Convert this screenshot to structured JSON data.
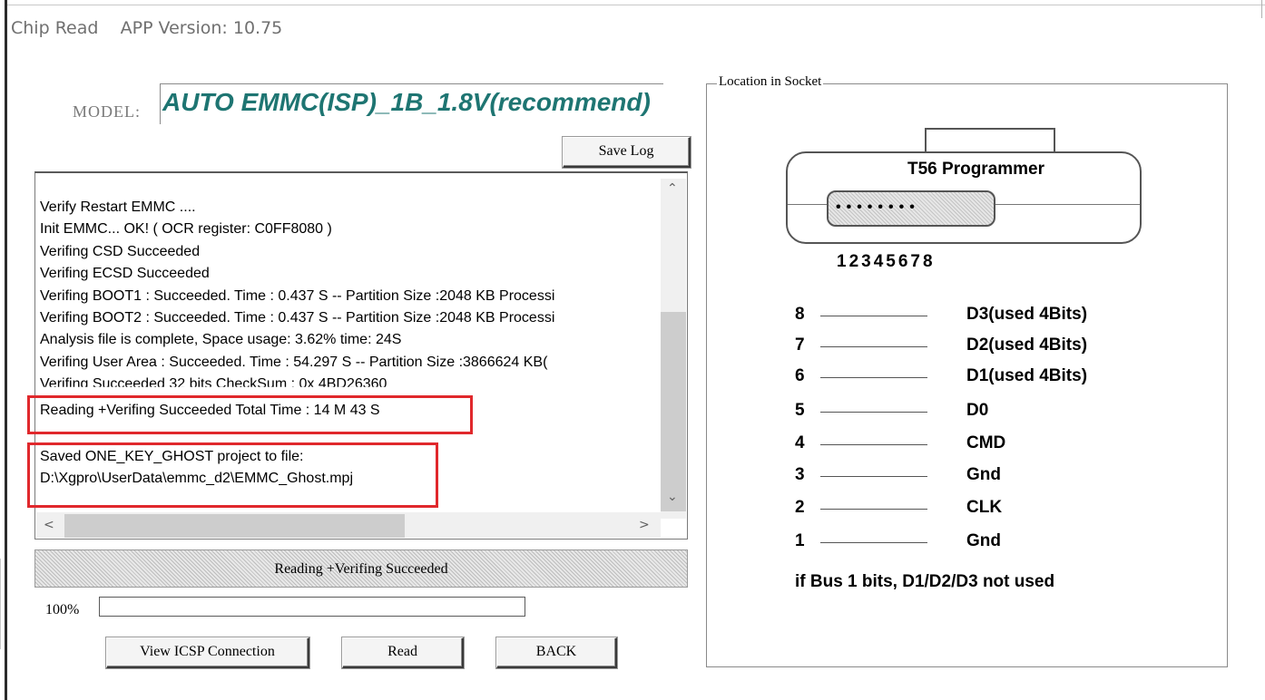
{
  "window": {
    "title": "Chip Read",
    "app_version": "APP Version: 10.75"
  },
  "model": {
    "label": "MODEL:",
    "value": "AUTO EMMC(ISP)_1B_1.8V(recommend)"
  },
  "toolbar": {
    "save_log_label": "Save Log"
  },
  "log": {
    "lines": [
      "Verify Restart EMMC ....",
      "Init EMMC... OK!   ( OCR register: C0FF8080 )",
      "Verifing CSD Succeeded",
      "Verifing ECSD Succeeded",
      "Verifing BOOT1 : Succeeded. Time : 0.437 S -- Partition Size :2048 KB Processi",
      "Verifing BOOT2 : Succeeded. Time : 0.437 S -- Partition Size :2048 KB Processi",
      "Analysis file is complete, Space usage: 3.62% time: 24S",
      "Verifing User Area : Succeeded. Time : 54.297 S -- Partition Size :3866624 KB(",
      "Verifing Succeeded  32 bits CheckSum :  0x 4BD26360",
      "Reading +Verifing  Succeeded   Total Time : 14 M 43 S",
      "",
      "Saved ONE_KEY_GHOST project to file:",
      "D:\\Xgpro\\UserData\\emmc_d2\\EMMC_Ghost.mpj"
    ]
  },
  "status": {
    "message": "Reading +Verifing  Succeeded",
    "progress_text": "100%",
    "progress_value": 1.0
  },
  "actions": {
    "view_icsp_label": "View ICSP Connection",
    "read_label": "Read",
    "back_label": "BACK"
  },
  "socket": {
    "group_title": "Location in Socket",
    "programmer_name": "T56 Programmer",
    "socket_dots": "••••••••",
    "pin_numbers": "12345678",
    "pins": [
      {
        "num": "8",
        "label": "D3(used 4Bits)"
      },
      {
        "num": "7",
        "label": "D2(used 4Bits)"
      },
      {
        "num": "6",
        "label": "D1(used 4Bits)"
      },
      {
        "num": "5",
        "label": "D0"
      },
      {
        "num": "4",
        "label": "CMD"
      },
      {
        "num": "3",
        "label": "Gnd"
      },
      {
        "num": "2",
        "label": "CLK"
      },
      {
        "num": "1",
        "label": "Gnd"
      }
    ],
    "bus_note": "if Bus  1 bits, D1/D2/D3 not used"
  },
  "colors": {
    "model_text": "#1e7572",
    "highlight_border": "#e0282c"
  }
}
